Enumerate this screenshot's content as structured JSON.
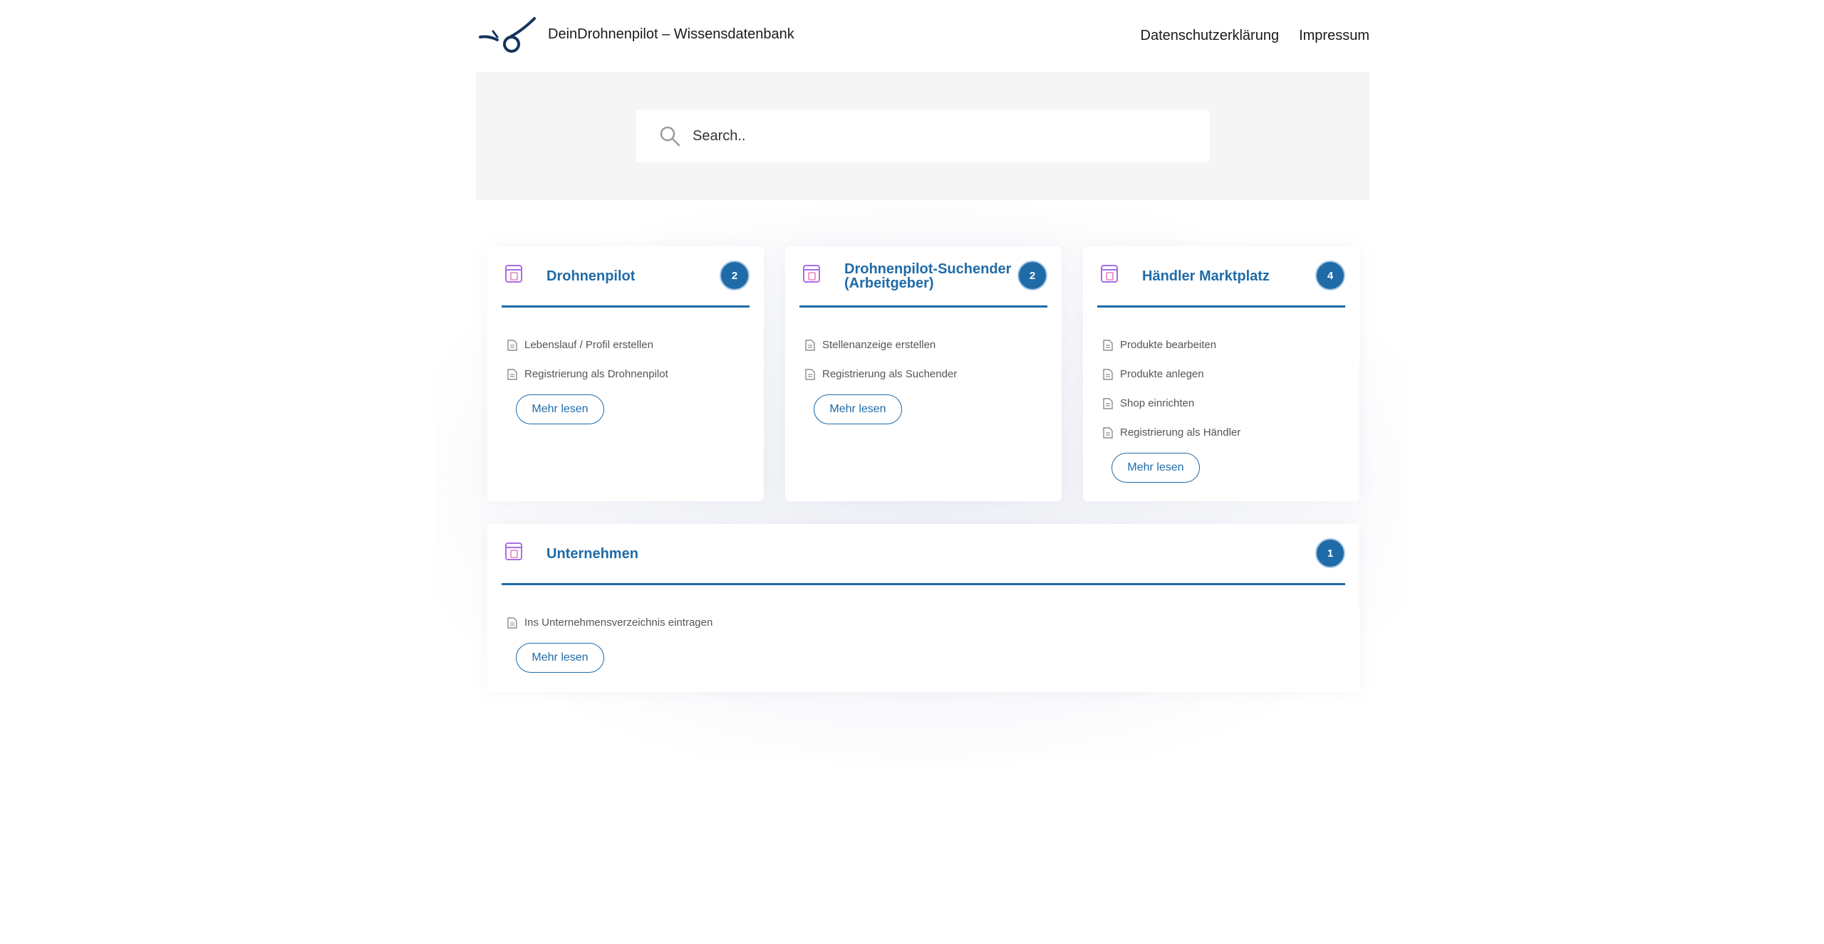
{
  "header": {
    "site_title": "DeinDrohnenpilot – Wissensdatenbank",
    "nav": [
      "Datenschutzerklärung",
      "Impressum"
    ]
  },
  "search": {
    "placeholder": "Search.."
  },
  "categories": [
    {
      "title": "Drohnenpilot",
      "count": "2",
      "articles": [
        "Lebenslauf / Profil erstellen",
        "Registrierung als Drohnenpilot"
      ],
      "more": "Mehr lesen"
    },
    {
      "title_line1": "Drohnenpilot-Suchender",
      "title_line2": "(Arbeitgeber)",
      "count": "2",
      "articles": [
        "Stellenanzeige erstellen",
        "Registrierung als Suchender"
      ],
      "more": "Mehr lesen"
    },
    {
      "title": "Händler Marktplatz",
      "count": "4",
      "articles": [
        "Produkte bearbeiten",
        "Produkte anlegen",
        "Shop einrichten",
        "Registrierung als Händler"
      ],
      "more": "Mehr lesen"
    },
    {
      "title": "Unternehmen",
      "count": "1",
      "articles": [
        "Ins Unternehmensverzeichnis eintragen"
      ],
      "more": "Mehr lesen"
    }
  ],
  "colors": {
    "accent": "#1f6ba8",
    "band": "#f5f5f5",
    "icon_purple": "#a86ee6"
  }
}
